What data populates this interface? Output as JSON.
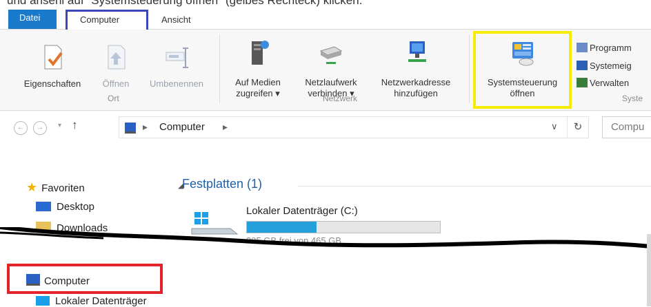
{
  "caption": "und ansehl auf \"Systemsteuerung öffnen\" (gelbes Rechteck) klicken.",
  "tabs": {
    "file": "Datei",
    "computer": "Computer",
    "view": "Ansicht"
  },
  "ribbon": {
    "properties": "Eigenschaften",
    "open": "Öffnen",
    "rename": "Umbenennen",
    "group_location": "Ort",
    "media_line1": "Auf Medien",
    "media_line2": "zugreifen ▾",
    "map_line1": "Netzlaufwerk",
    "map_line2": "verbinden ▾",
    "netaddr_line1": "Netzwerkadresse",
    "netaddr_line2": "hinzufügen",
    "group_network": "Netzwerk",
    "control_line1": "Systemsteuerung",
    "control_line2": "öffnen",
    "programs": "Programm",
    "system": "Systemeig",
    "manage": "Verwalten",
    "group_system": "Syste"
  },
  "address": {
    "path": "Computer",
    "search_placeholder": "Compu"
  },
  "sidebar": {
    "favorites": "Favoriten",
    "desktop": "Desktop",
    "downloads": "Downloads",
    "computer": "Computer",
    "local_disk": "Lokaler Datenträger"
  },
  "main": {
    "section": "Festplatten (1)",
    "drive_name": "Lokaler Datenträger (C:)",
    "drive_usage": 0.36,
    "drive_space": "305 GB frei von 465 GB"
  },
  "colors": {
    "highlight_yellow": "#f6ec00",
    "highlight_red": "#e3232a",
    "highlight_blue": "#3a47b8",
    "accent": "#1979ca"
  }
}
